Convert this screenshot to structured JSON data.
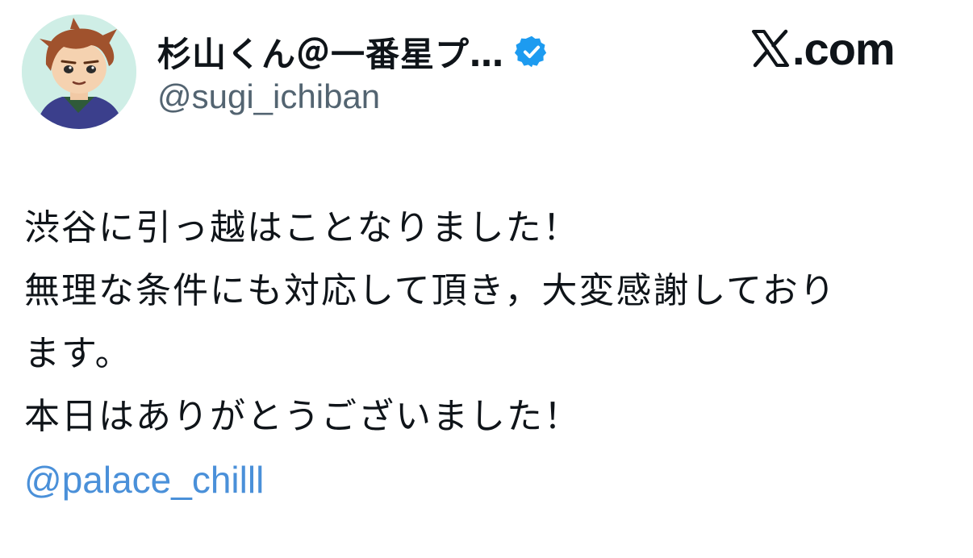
{
  "author": {
    "display_name": "杉山くん＠一番星プ…",
    "handle": "@sugi_ichiban",
    "verified": true,
    "avatar_icon": "cartoon-avatar-icon"
  },
  "brand": {
    "text": ".com",
    "logo_icon": "x-logo-icon"
  },
  "tweet": {
    "lines": [
      "渋谷に引っ越はことなりました！",
      "無理な条件にも対応して頂き，大変感謝しており",
      "ます。",
      "本日はありがとうございました！"
    ],
    "mention": "@palace_chilll"
  },
  "colors": {
    "text": "#0f1419",
    "secondary_text": "#536471",
    "link": "#4a90d9",
    "verified_badge": "#1d9bf0",
    "background": "#ffffff"
  }
}
